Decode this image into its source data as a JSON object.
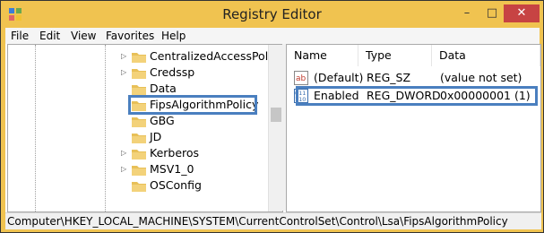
{
  "window": {
    "title": "Registry Editor",
    "accent": "#f0c350",
    "controls": {
      "minimize": "–",
      "maximize": "□",
      "close": "✕"
    }
  },
  "menu": [
    "File",
    "Edit",
    "View",
    "Favorites",
    "Help"
  ],
  "tree": {
    "items": [
      {
        "label": "CentralizedAccessPolicie",
        "expandable": true
      },
      {
        "label": "Credssp",
        "expandable": true
      },
      {
        "label": "Data",
        "expandable": false
      },
      {
        "label": "FipsAlgorithmPolicy",
        "expandable": false,
        "selected": true
      },
      {
        "label": "GBG",
        "expandable": false
      },
      {
        "label": "JD",
        "expandable": false
      },
      {
        "label": "Kerberos",
        "expandable": true
      },
      {
        "label": "MSV1_0",
        "expandable": true
      },
      {
        "label": "OSConfig",
        "expandable": false
      }
    ]
  },
  "list": {
    "columns": [
      "Name",
      "Type",
      "Data"
    ],
    "rows": [
      {
        "icon": "string-value-icon",
        "name": "(Default)",
        "type": "REG_SZ",
        "data": "(value not set)"
      },
      {
        "icon": "dword-value-icon",
        "name": "Enabled",
        "type": "REG_DWORD",
        "data": "0x00000001 (1)",
        "highlighted": true
      }
    ]
  },
  "status": {
    "path": "Computer\\HKEY_LOCAL_MACHINE\\SYSTEM\\CurrentControlSet\\Control\\Lsa\\FipsAlgorithmPolicy"
  },
  "colors": {
    "highlight_border": "#4a7fbf",
    "folder": "#e8c058",
    "close_button": "#c74343"
  }
}
